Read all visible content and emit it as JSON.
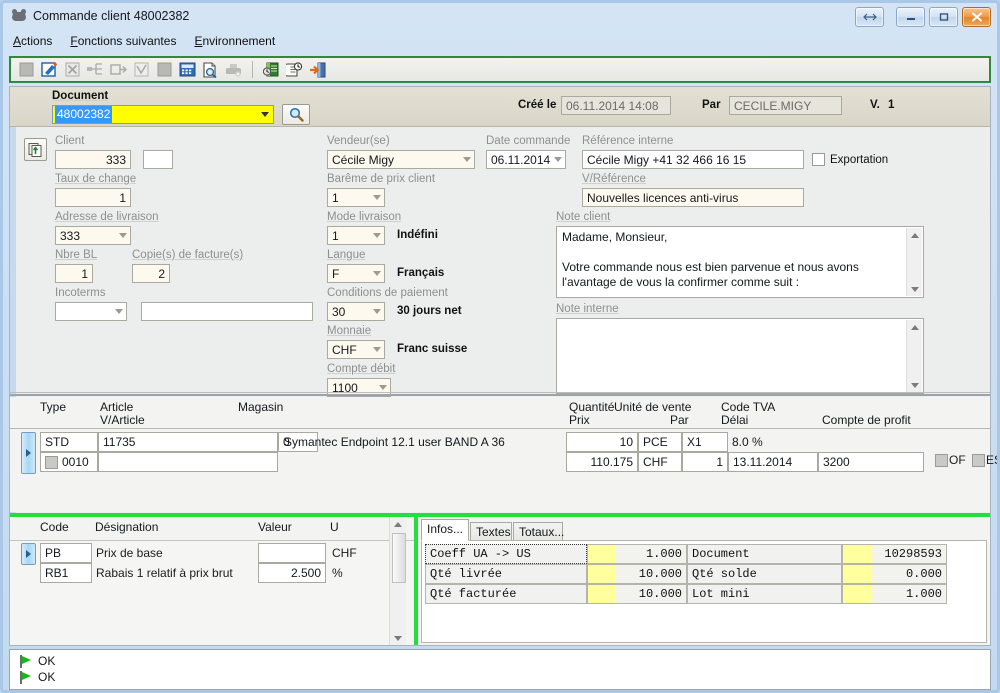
{
  "window": {
    "title": "Commande client 48002382",
    "icon": "app-icon",
    "buttons": {
      "restore_size": "⇔",
      "minimize": "–",
      "maximize": "□",
      "close": "✕"
    }
  },
  "menubar": {
    "items": [
      {
        "label": "Actions",
        "accel": "A"
      },
      {
        "label": "Fonctions suivantes",
        "accel": "F"
      },
      {
        "label": "Environnement",
        "accel": "E"
      }
    ]
  },
  "toolbar": {
    "border_color": "#2d8a3e",
    "buttons": [
      {
        "name": "stop-icon",
        "enabled": false
      },
      {
        "name": "edit-icon",
        "enabled": true
      },
      {
        "name": "delete-x-icon",
        "enabled": false
      },
      {
        "name": "insert-line-icon",
        "enabled": false
      },
      {
        "name": "duplicate-line-icon",
        "enabled": false
      },
      {
        "name": "validate-check-icon",
        "enabled": false
      },
      {
        "name": "square-stop-icon",
        "enabled": false
      },
      {
        "name": "calculator-icon",
        "enabled": true
      },
      {
        "name": "preview-document-icon",
        "enabled": true
      },
      {
        "name": "print-icon",
        "enabled": false
      },
      {
        "name": "history-book-icon",
        "enabled": true
      },
      {
        "name": "notes-clock-icon",
        "enabled": true
      },
      {
        "name": "exit-door-icon",
        "enabled": true
      }
    ]
  },
  "header": {
    "document_label": "Document",
    "document_value": "48002382",
    "search_icon": "magnifier-icon",
    "created_label": "Créé le",
    "created_value": "06.11.2014 14:08",
    "by_label": "Par",
    "by_value": "CECILE.MIGY",
    "version_label": "V.",
    "version_value": "1"
  },
  "form": {
    "copy_icon": "copy-document-icon",
    "client_label": "Client",
    "client_value": "333",
    "client_suffix": "",
    "rate_label": "Taux de change",
    "rate_value": "1",
    "delivery_address_label": "Adresse de livraison",
    "delivery_address_value": "333",
    "bl_count_label": "Nbre BL",
    "bl_count_value": "1",
    "invoice_copies_label": "Copie(s) de facture(s)",
    "invoice_copies_value": "2",
    "incoterms_label": "Incoterms",
    "incoterms_value": "",
    "incoterms_text": "",
    "seller_label": "Vendeur(se)",
    "seller_value": "Cécile Migy",
    "price_scale_label": "Barême de prix client",
    "price_scale_value": "1",
    "delivery_mode_label": "Mode livraison",
    "delivery_mode_value": "1",
    "delivery_mode_text": "Indéfini",
    "language_label": "Langue",
    "language_value": "F",
    "language_text": "Français",
    "payment_terms_label": "Conditions de paiement",
    "payment_terms_value": "30",
    "payment_terms_text": "30 jours net",
    "currency_label": "Monnaie",
    "currency_value": "CHF",
    "currency_text": "Franc suisse",
    "debit_account_label": "Compte débit",
    "debit_account_value": "1100",
    "order_date_label": "Date commande",
    "order_date_value": "06.11.2014",
    "internal_ref_label": "Référence interne",
    "internal_ref_value": "Cécile Migy +41 32 466 16 15",
    "export_label": "Exportation",
    "export_checked": false,
    "your_ref_label": "V/Référence",
    "your_ref_value": "Nouvelles licences anti-virus",
    "client_note_label": "Note client",
    "client_note_value": "Madame, Monsieur,\n\nVotre commande nous est bien parvenue et nous avons\nl'avantage de vous la confirmer comme suit :",
    "internal_note_label": "Note interne",
    "internal_note_value": ""
  },
  "lines_grid": {
    "headers_row1": [
      "Type",
      "Article",
      "Magasin",
      "Quantité",
      "Unité de vente",
      "Code TVA"
    ],
    "headers_row2": [
      "V/Article",
      "Prix",
      "Par",
      "Délai",
      "Compte de profit"
    ],
    "rows": [
      {
        "type": "STD",
        "article": "11735",
        "magasin": "0",
        "designation": "Symantec Endpoint 12.1 user BAND A 36",
        "quantity": "10",
        "unit": "PCE",
        "par": "X1",
        "tva": "8.0 %",
        "line_no": "0010",
        "v_article": "",
        "price": "110.175",
        "currency": "CHF",
        "par2": "1",
        "delay": "13.11.2014",
        "profit_account": "3200",
        "of_label": "OF",
        "es_label": "ES"
      }
    ]
  },
  "price_grid": {
    "headers": [
      "Code",
      "Désignation",
      "Valeur",
      "U"
    ],
    "rows": [
      {
        "code": "PB",
        "designation": "Prix de base",
        "value": "",
        "unit": "CHF"
      },
      {
        "code": "RB1",
        "designation": "Rabais 1 relatif à prix brut",
        "value": "2.500",
        "unit": "%"
      }
    ]
  },
  "info_panel": {
    "tabs": [
      {
        "label": "Infos...",
        "active": true
      },
      {
        "label": "Textes",
        "active": false
      },
      {
        "label": "Totaux...",
        "active": false
      }
    ],
    "fields": [
      {
        "label": "Coeff UA -> US",
        "value": "1.000",
        "label2": "Document",
        "value2": "10298593"
      },
      {
        "label": "Qté livrée",
        "value": "10.000",
        "label2": "Qté solde",
        "value2": "0.000"
      },
      {
        "label": "Qté facturée",
        "value": "10.000",
        "label2": "Lot mini",
        "value2": "1.000"
      }
    ]
  },
  "status": {
    "lines": [
      {
        "icon": "green-flag-icon",
        "text": "OK"
      },
      {
        "icon": "green-flag-icon",
        "text": "OK"
      }
    ]
  },
  "colors": {
    "toolbar_border": "#2d8a3e",
    "separator_green": "#22e03a",
    "highlight_yellow": "#ffff00",
    "info_yellow": "#ffff9e",
    "selection_blue": "#3399ff"
  }
}
